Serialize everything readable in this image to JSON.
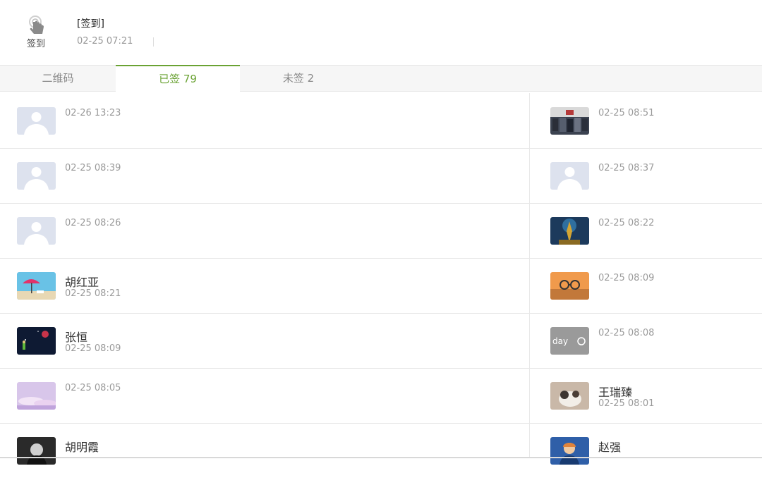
{
  "header": {
    "checkin_label": "签到",
    "title": "[签到]",
    "time": "02-25 07:21"
  },
  "tabs": [
    {
      "label": "二维码"
    },
    {
      "label": "已签 79"
    },
    {
      "label": "未签 2"
    }
  ],
  "records": [
    {
      "name": "",
      "time": "02-26 13:23",
      "avatar": "default"
    },
    {
      "name": "",
      "time": "02-25 08:51",
      "avatar": "group-photo"
    },
    {
      "name": "",
      "time": "02-25 08:39",
      "avatar": "default"
    },
    {
      "name": "",
      "time": "02-25 08:37",
      "avatar": "default"
    },
    {
      "name": "",
      "time": "02-25 08:26",
      "avatar": "default"
    },
    {
      "name": "",
      "time": "02-25 08:22",
      "avatar": "golden-statue"
    },
    {
      "name": "胡红亚",
      "time": "02-25 08:21",
      "avatar": "beach-umbrella"
    },
    {
      "name": "",
      "time": "02-25 08:09",
      "avatar": "glasses-sunset"
    },
    {
      "name": "张恒",
      "time": "02-25 08:09",
      "avatar": "night-planet"
    },
    {
      "name": "",
      "time": "02-25 08:08",
      "avatar": "day-sun"
    },
    {
      "name": "",
      "time": "02-25 08:05",
      "avatar": "pink-clouds"
    },
    {
      "name": "王瑞臻",
      "time": "02-25 08:01",
      "avatar": "cat"
    },
    {
      "name": "胡明霞",
      "time": "",
      "avatar": "dark-portrait"
    },
    {
      "name": "赵强",
      "time": "",
      "avatar": "blue-portrait"
    }
  ],
  "avatar_images": {
    "day-sun": "day"
  }
}
